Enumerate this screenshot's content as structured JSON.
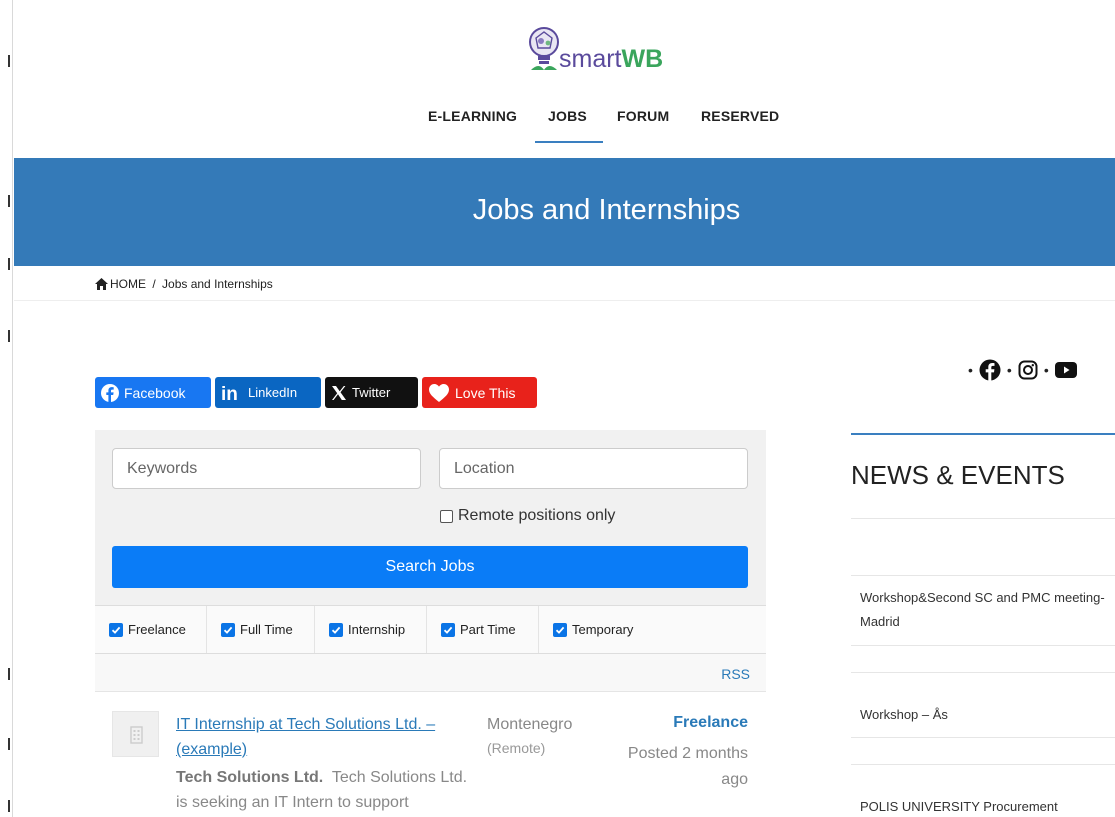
{
  "brand": {
    "name_part1": "smart",
    "name_part2": "WB"
  },
  "nav": {
    "items": [
      "E-LEARNING",
      "JOBS",
      "FORUM",
      "RESERVED"
    ],
    "active": "JOBS"
  },
  "hero": {
    "title": "Jobs and Internships"
  },
  "breadcrumb": {
    "home": "HOME",
    "separator": "/",
    "current": "Jobs and Internships"
  },
  "share": {
    "facebook": "Facebook",
    "linkedin": "LinkedIn",
    "twitter": "Twitter",
    "love": "Love This"
  },
  "search": {
    "keywords_placeholder": "Keywords",
    "location_placeholder": "Location",
    "remote_label": "Remote positions only",
    "button_label": "Search Jobs"
  },
  "job_types": [
    {
      "label": "Freelance",
      "checked": true
    },
    {
      "label": "Full Time",
      "checked": true
    },
    {
      "label": "Internship",
      "checked": true
    },
    {
      "label": "Part Time",
      "checked": true
    },
    {
      "label": "Temporary",
      "checked": true
    }
  ],
  "rss_label": "RSS",
  "job": {
    "title": "IT Internship at Tech Solutions Ltd. – (example)",
    "company": "Tech Solutions Ltd.",
    "description": "Tech Solutions Ltd. is seeking an IT Intern to support",
    "location": "Montenegro",
    "location_note": "(Remote)",
    "type": "Freelance",
    "posted": "Posted 2 months ago"
  },
  "sidebar": {
    "heading": "NEWS & EVENTS",
    "items": [
      "Workshop&Second SC and PMC meeting-Madrid",
      "Workshop – Ås",
      "POLIS UNIVERSITY Procurement"
    ]
  },
  "colors": {
    "hero": "#347ab8",
    "accent": "#2a7ab8",
    "search_button": "#0a7cf7",
    "facebook": "#1877f2",
    "linkedin": "#0a66c2",
    "twitter": "#111111",
    "love": "#e8221b"
  },
  "icons": [
    "lightbulb-logo-icon",
    "home-icon",
    "facebook-icon",
    "linkedin-icon",
    "x-icon",
    "heart-icon",
    "checkbox-checked-icon",
    "instagram-icon",
    "youtube-icon"
  ]
}
